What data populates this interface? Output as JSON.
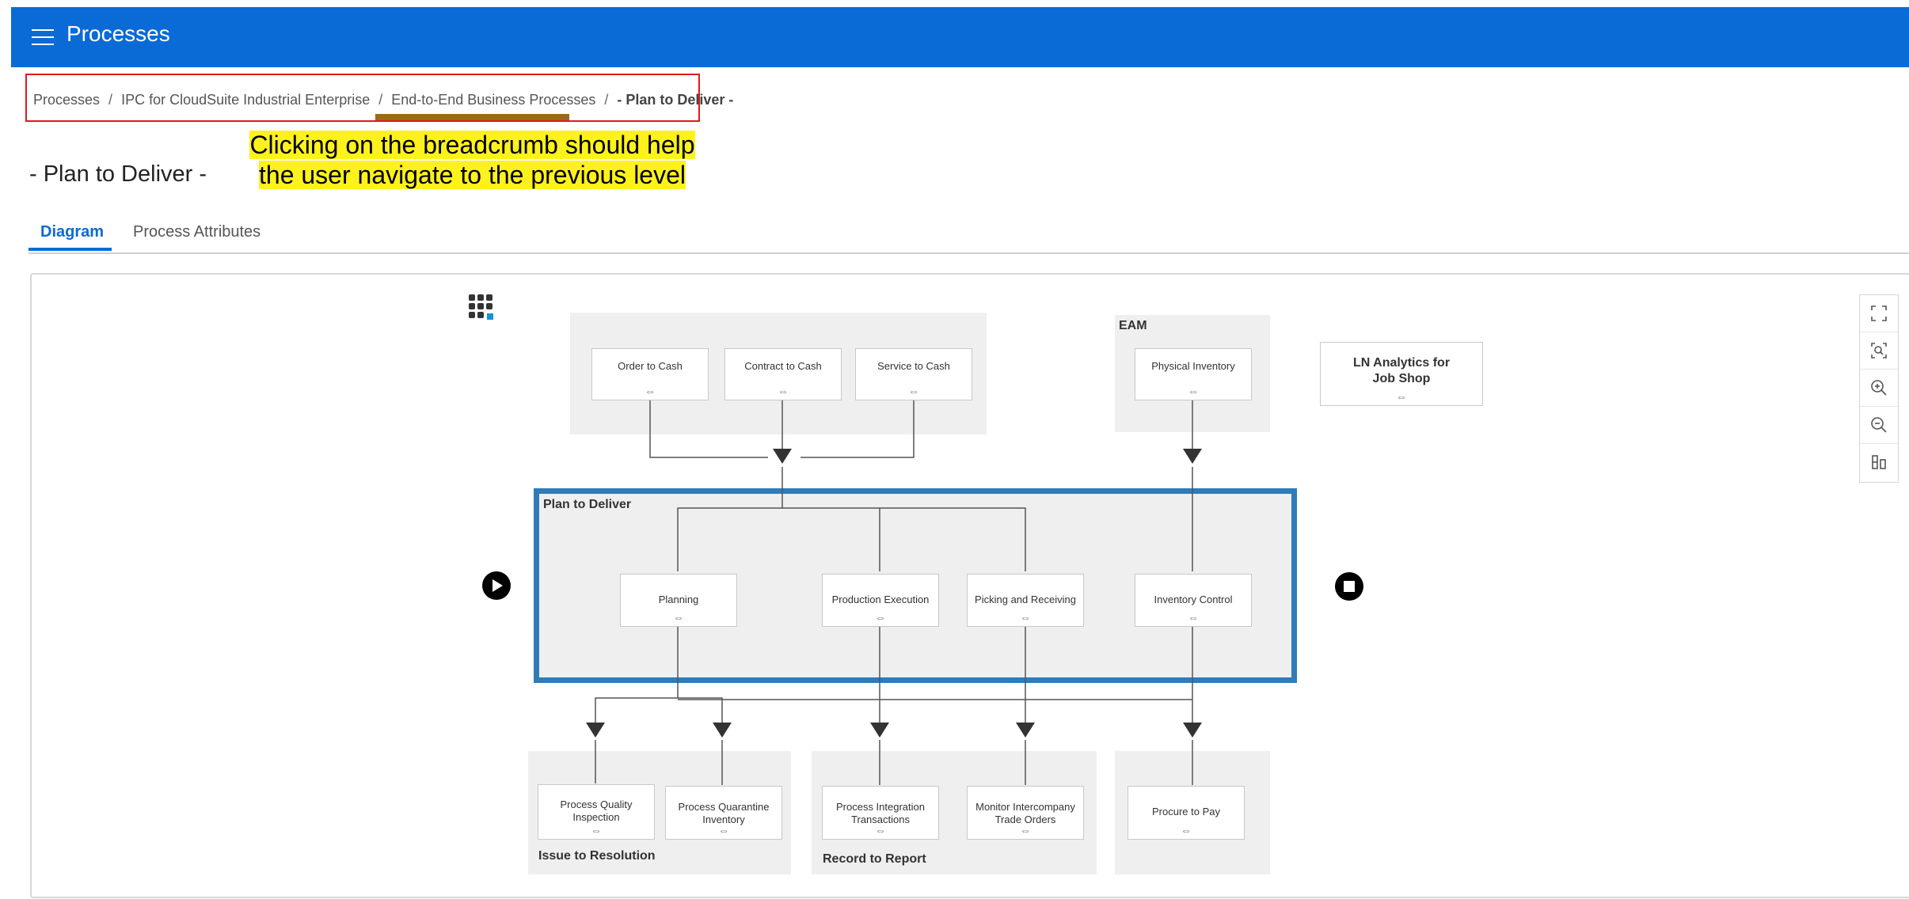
{
  "app": {
    "title": "Processes"
  },
  "breadcrumb": {
    "items": [
      "Processes",
      "IPC for CloudSuite Industrial Enterprise",
      "End-to-End Business Processes"
    ],
    "current": "- Plan to Deliver -",
    "separator": "/"
  },
  "annotation": {
    "line1": "Clicking on the breadcrumb should help",
    "line2": "the user navigate to the previous level"
  },
  "page": {
    "title": "- Plan to Deliver -"
  },
  "tabs": [
    {
      "label": "Diagram",
      "active": true
    },
    {
      "label": "Process Attributes",
      "active": false
    }
  ],
  "diagram": {
    "groups": {
      "eam": "EAM",
      "plan_to_deliver": "Plan to Deliver",
      "issue_to_resolution": "Issue to Resolution",
      "record_to_report": "Record to Report"
    },
    "nodes": {
      "order_to_cash": "Order to Cash",
      "contract_to_cash": "Contract to Cash",
      "service_to_cash": "Service to Cash",
      "physical_inventory": "Physical Inventory",
      "ln_analytics": "LN Analytics for Job Shop",
      "planning": "Planning",
      "production_execution": "Production Execution",
      "picking_receiving": "Picking and Receiving",
      "inventory_control": "Inventory Control",
      "quality_inspection": "Process Quality Inspection",
      "quarantine_inventory": "Process Quarantine Inventory",
      "integration_transactions": "Process Integration Transactions",
      "intercompany_trade_orders": "Monitor Intercompany Trade Orders",
      "procure_to_pay": "Procure to Pay"
    },
    "link_glyph": "⇔",
    "toolbar": [
      "fullscreen-icon",
      "zoom-fit-icon",
      "zoom-in-icon",
      "zoom-out-icon",
      "layout-icon"
    ]
  },
  "colors": {
    "header": "#0a6ad6",
    "accent": "#0a6ad6",
    "highlight_frame": "#2f7cb8",
    "annotation_bg": "#fff21c",
    "callout_border": "#e0191c"
  }
}
